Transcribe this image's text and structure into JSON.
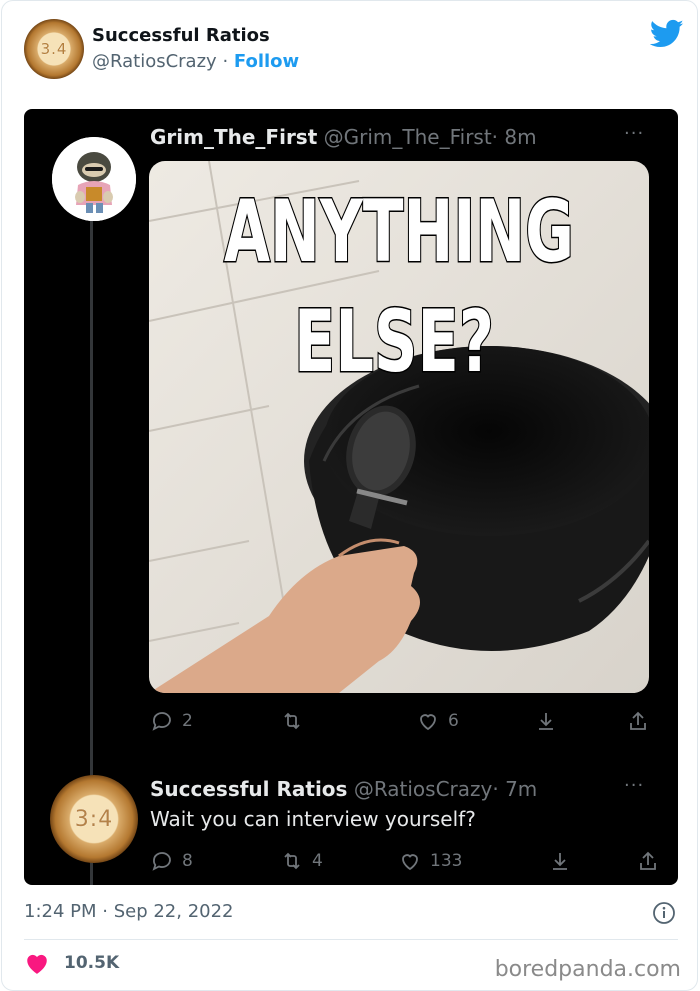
{
  "embed": {
    "author": {
      "name": "Successful Ratios",
      "handle": "@RatiosCrazy",
      "separator": "·",
      "follow_label": "Follow",
      "avatar_text": "3.4"
    },
    "timestamp": "1:24 PM · Sep 22, 2022",
    "likes": "10.5K",
    "accent_color": "#1d9bf0",
    "icons": [
      "twitter-bird-icon",
      "info-icon",
      "heart-icon"
    ]
  },
  "screenshot": {
    "tweet": {
      "name": "Grim_The_First",
      "handle": "@Grim_The_First",
      "time": "· 8m",
      "menu": "···",
      "meme_text_line1": "ANYTHING",
      "meme_text_line2": "ELSE?",
      "stats": {
        "replies": "2",
        "retweets": "",
        "likes": "6"
      }
    },
    "reply": {
      "name": "Successful Ratios",
      "handle": "@RatiosCrazy",
      "time": "· 7m",
      "menu": "···",
      "avatar_text": "3:4",
      "text": "Wait you can interview yourself?",
      "stats": {
        "replies": "8",
        "retweets": "4",
        "likes": "133"
      }
    }
  },
  "watermark": "boredpanda.com"
}
